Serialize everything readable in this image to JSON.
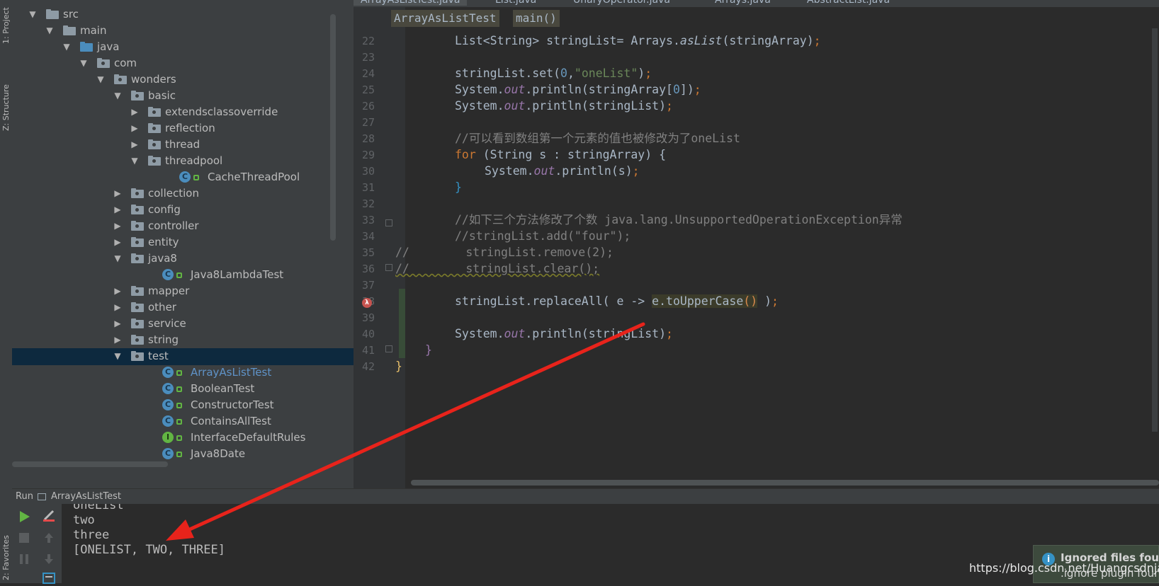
{
  "side_tabs": {
    "project": "1: Project",
    "structure": "Z: Structure",
    "favorites": "2: Favorites"
  },
  "editor_tabs": [
    "ArrayAsListTest.java",
    "List.java",
    "UnaryOperator.java",
    "Arrays.java",
    "AbstractList.java"
  ],
  "breadcrumbs": {
    "class": "ArrayAsListTest",
    "method": "main()"
  },
  "tree": [
    {
      "label": "src",
      "level": 1,
      "expanded": true,
      "icon": "folder"
    },
    {
      "label": "main",
      "level": 2,
      "expanded": true,
      "icon": "folder"
    },
    {
      "label": "java",
      "level": 3,
      "expanded": true,
      "icon": "source-folder"
    },
    {
      "label": "com",
      "level": 4,
      "expanded": true,
      "icon": "package"
    },
    {
      "label": "wonders",
      "level": 5,
      "expanded": true,
      "icon": "package"
    },
    {
      "label": "basic",
      "level": 6,
      "expanded": true,
      "icon": "package"
    },
    {
      "label": "extendsclassoverride",
      "level": 7,
      "expanded": false,
      "icon": "package"
    },
    {
      "label": "reflection",
      "level": 7,
      "expanded": false,
      "icon": "package"
    },
    {
      "label": "thread",
      "level": 7,
      "expanded": false,
      "icon": "package"
    },
    {
      "label": "threadpool",
      "level": 7,
      "expanded": true,
      "icon": "package"
    },
    {
      "label": "CacheThreadPool",
      "level": 9,
      "icon": "class"
    },
    {
      "label": "collection",
      "level": 6,
      "expanded": false,
      "icon": "package"
    },
    {
      "label": "config",
      "level": 6,
      "expanded": false,
      "icon": "package"
    },
    {
      "label": "controller",
      "level": 6,
      "expanded": false,
      "icon": "package"
    },
    {
      "label": "entity",
      "level": 6,
      "expanded": false,
      "icon": "package"
    },
    {
      "label": "java8",
      "level": 6,
      "expanded": true,
      "icon": "package"
    },
    {
      "label": "Java8LambdaTest",
      "level": 8,
      "icon": "class"
    },
    {
      "label": "mapper",
      "level": 6,
      "expanded": false,
      "icon": "package"
    },
    {
      "label": "other",
      "level": 6,
      "expanded": false,
      "icon": "package"
    },
    {
      "label": "service",
      "level": 6,
      "expanded": false,
      "icon": "package"
    },
    {
      "label": "string",
      "level": 6,
      "expanded": false,
      "icon": "package"
    },
    {
      "label": "test",
      "level": 6,
      "expanded": true,
      "icon": "package",
      "selected": true
    },
    {
      "label": "ArrayAsListTest",
      "level": 8,
      "icon": "class",
      "highlight": true
    },
    {
      "label": "BooleanTest",
      "level": 8,
      "icon": "class"
    },
    {
      "label": "ConstructorTest",
      "level": 8,
      "icon": "class"
    },
    {
      "label": "ContainsAllTest",
      "level": 8,
      "icon": "class"
    },
    {
      "label": "InterfaceDefaultRules",
      "level": 8,
      "icon": "interface"
    },
    {
      "label": "Java8Date",
      "level": 8,
      "icon": "class"
    }
  ],
  "line_numbers": [
    "22",
    "23",
    "24",
    "25",
    "26",
    "27",
    "28",
    "29",
    "30",
    "31",
    "32",
    "33",
    "34",
    "35",
    "36",
    "37",
    "38",
    "39",
    "40",
    "41",
    "42"
  ],
  "code": {
    "l22": "List<String> stringList= Arrays.asList(stringArray);",
    "l24": "stringList.set(0,\"oneList\");",
    "l25": "System.out.println(stringArray[0]);",
    "l26": "System.out.println(stringList);",
    "l28": "//可以看到数组第一个元素的值也被修改为了oneList",
    "l29": "for (String s : stringArray) {",
    "l30": "System.out.println(s);",
    "l31": "}",
    "l33": "//如下三个方法修改了个数 java.lang.UnsupportedOperationException异常",
    "l34": "//stringList.add(\"four\");",
    "l35": "//        stringList.remove(2);",
    "l36": "//        stringList.clear();",
    "l38": "stringList.replaceAll( e -> e.toUpperCase() );",
    "l40": "System.out.println(stringList);",
    "l41": "}",
    "l42": "}"
  },
  "run": {
    "title": "Run",
    "config": "ArrayAsListTest"
  },
  "console": [
    "oneList",
    "two",
    "three",
    "[ONELIST, TWO, THREE]"
  ],
  "notification": {
    "title": "Ignored files found",
    "text": ".ignore plugin found"
  },
  "watermark": "https://blog.csdn.net/Huangcsdnjava",
  "colors": {
    "keyword": "#cc7832",
    "string": "#6a8759",
    "number": "#6897bb",
    "field": "#9876aa",
    "comment": "#808080",
    "arrow": "#e8231b"
  }
}
